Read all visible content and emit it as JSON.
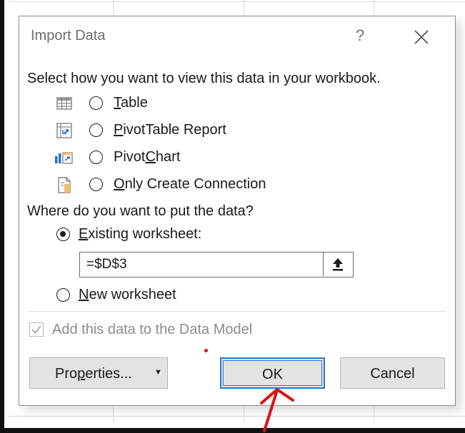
{
  "dialog": {
    "title": "Import Data",
    "help_glyph": "?",
    "instruction": "Select how you want to view this data in your workbook.",
    "view_options": [
      {
        "pre": "",
        "accel": "T",
        "post": "able",
        "icon": "table-icon",
        "selected": true
      },
      {
        "pre": "",
        "accel": "P",
        "post": "ivotTable Report",
        "icon": "pivottable-icon",
        "selected": false
      },
      {
        "pre": "Pivot",
        "accel": "C",
        "post": "hart",
        "icon": "pivotchart-icon",
        "selected": false
      },
      {
        "pre": "",
        "accel": "O",
        "post": "nly Create Connection",
        "icon": "connection-icon",
        "selected": false
      }
    ],
    "where_label": "Where do you want to put the data?",
    "placement": {
      "existing": {
        "accel": "E",
        "post": "xisting worksheet:",
        "selected": true
      },
      "reference_value": "=$D$3",
      "new": {
        "accel": "N",
        "post": "ew worksheet",
        "selected": false
      }
    },
    "data_model": {
      "label": "Add this data to the Data Model",
      "checked": true,
      "disabled": true
    },
    "buttons": {
      "properties": {
        "pre": "Pro",
        "accel": "p",
        "post": "erties...",
        "dropdown_glyph": "▼"
      },
      "ok": "OK",
      "cancel": "Cancel"
    }
  },
  "annotation": {
    "color": "#e01010",
    "shape": "hand-drawn arrow pointing to OK button"
  },
  "colors": {
    "accent": "#2b78d0",
    "text": "#1a1a1a",
    "muted": "#8d8d8d",
    "button_bg": "#e3e3e3"
  }
}
